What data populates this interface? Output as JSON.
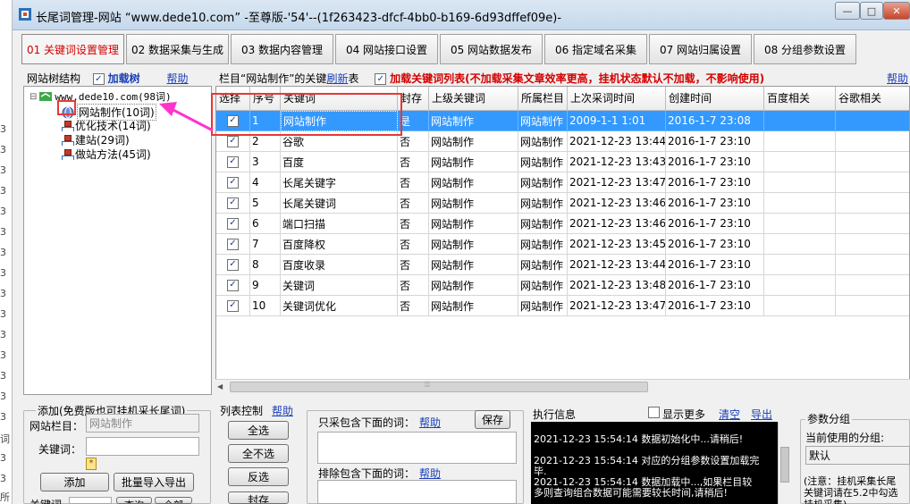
{
  "window": {
    "title": "长尾词管理-网站 “www.dede10.com” -至尊版-'54'--(1f263423-dfcf-4bb0-b169-6d93dffef09e)-",
    "btn_min": "—",
    "btn_max": "□",
    "btn_close": "✕"
  },
  "tabs": [
    {
      "label": "01 关键词设置管理",
      "active": true
    },
    {
      "label": "02 数据采集与生成",
      "active": false
    },
    {
      "label": "03 数据内容管理",
      "active": false
    },
    {
      "label": "04 网站接口设置",
      "active": false
    },
    {
      "label": "05 网站数据发布",
      "active": false
    },
    {
      "label": "06 指定域名采集",
      "active": false
    },
    {
      "label": "07 网站归属设置",
      "active": false
    },
    {
      "label": "08 分组参数设置",
      "active": false
    }
  ],
  "left_panel": {
    "title": "网站树结构",
    "load_tree_label": "加载树",
    "help": "帮助",
    "tree": {
      "root": "www.dede10.com(98词)",
      "children": [
        "网站制作(10词)",
        "优化技术(14词)",
        "建站(29词)",
        "做站方法(45词)"
      ]
    }
  },
  "grid": {
    "header_prefix": "栏目“网站制作”的关键",
    "refresh": "刷新",
    "header_suffix": "表",
    "load_label": "加载关键词列表",
    "load_note": "(不加载采集文章效率更高，挂机状态默认不加载，不影响使用)",
    "help": "帮助",
    "columns": [
      "选择",
      "序号",
      "关键词",
      "封存",
      "上级关键词",
      "所属栏目",
      "上次采词时间",
      "创建时间",
      "百度相关",
      "谷歌相关"
    ],
    "rows": [
      {
        "no": "1",
        "kw": "网站制作",
        "sealed": "是",
        "parent": "网站制作",
        "cat": "网站制作",
        "last": "2009-1-1  1:01",
        "created": "2016-1-7  23:08"
      },
      {
        "no": "2",
        "kw": "谷歌",
        "sealed": "否",
        "parent": "网站制作",
        "cat": "网站制作",
        "last": "2021-12-23  13:44",
        "created": "2016-1-7  23:10"
      },
      {
        "no": "3",
        "kw": "百度",
        "sealed": "否",
        "parent": "网站制作",
        "cat": "网站制作",
        "last": "2021-12-23  13:43",
        "created": "2016-1-7  23:10"
      },
      {
        "no": "4",
        "kw": "长尾关键字",
        "sealed": "否",
        "parent": "网站制作",
        "cat": "网站制作",
        "last": "2021-12-23  13:47",
        "created": "2016-1-7  23:10"
      },
      {
        "no": "5",
        "kw": "长尾关键词",
        "sealed": "否",
        "parent": "网站制作",
        "cat": "网站制作",
        "last": "2021-12-23  13:46",
        "created": "2016-1-7  23:10"
      },
      {
        "no": "6",
        "kw": "端口扫描",
        "sealed": "否",
        "parent": "网站制作",
        "cat": "网站制作",
        "last": "2021-12-23  13:46",
        "created": "2016-1-7  23:10"
      },
      {
        "no": "7",
        "kw": "百度降权",
        "sealed": "否",
        "parent": "网站制作",
        "cat": "网站制作",
        "last": "2021-12-23  13:45",
        "created": "2016-1-7  23:10"
      },
      {
        "no": "8",
        "kw": "百度收录",
        "sealed": "否",
        "parent": "网站制作",
        "cat": "网站制作",
        "last": "2021-12-23  13:44",
        "created": "2016-1-7  23:10"
      },
      {
        "no": "9",
        "kw": "关键词",
        "sealed": "否",
        "parent": "网站制作",
        "cat": "网站制作",
        "last": "2021-12-23  13:48",
        "created": "2016-1-7  23:10"
      },
      {
        "no": "10",
        "kw": "关键词优化",
        "sealed": "否",
        "parent": "网站制作",
        "cat": "网站制作",
        "last": "2021-12-23  13:47",
        "created": "2016-1-7  23:10"
      }
    ]
  },
  "add_panel": {
    "title": "添加(免费版也可挂机采长尾词)",
    "column_label": "网站栏目：",
    "column_value": "网站制作",
    "keyword_label": "关键词：",
    "star": "*",
    "add_btn": "添加",
    "batch_btn": "批量导入导出",
    "kw_label_bottom": "关键词",
    "query_btn": "查询",
    "all_btn": "全部"
  },
  "list_control": {
    "title": "列表控制",
    "help": "帮助",
    "select_all": "全选",
    "select_none": "全不选",
    "invert": "反选",
    "seal": "封存"
  },
  "filters": {
    "include_label": "只采包含下面的词：",
    "include_help": "帮助",
    "save_btn": "保存",
    "exclude_label": "排除包含下面的词：",
    "exclude_help": "帮助"
  },
  "exec_info": {
    "title": "执行信息",
    "show_more": "显示更多",
    "clear": "清空",
    "export": "导出",
    "log": [
      "2021-12-23 15:54:14   数据初始化中...请稍后!",
      "2021-12-23 15:54:14   对应的分组参数设置加载完",
      "毕.",
      "2021-12-23 15:54:14   数据加载中...,如果栏目较",
      "多则查询组合数据可能需要较长时间,请稍后!"
    ]
  },
  "param_group": {
    "title": "参数分组",
    "current_label": "当前使用的分组:",
    "current_value": "默认",
    "note_line1": "(注意：挂机采集长尾",
    "note_line2": "关键词请在5.2中勾选",
    "note_line3": "挂机采集)"
  },
  "bg_strip": {
    "numbers": [
      "3",
      "3",
      "3",
      "3",
      "3",
      "3",
      "3",
      "3",
      "3",
      "3",
      "3",
      "3",
      "3",
      "3",
      "3",
      "3",
      "3",
      "3"
    ],
    "bottom_chars": [
      "词",
      "所"
    ]
  },
  "colors": {
    "selection": "#3399ff",
    "highlight_box": "#e53935",
    "arrow": "#ff33cc",
    "tab_active": "#d40000",
    "link": "#1a3fb8"
  }
}
